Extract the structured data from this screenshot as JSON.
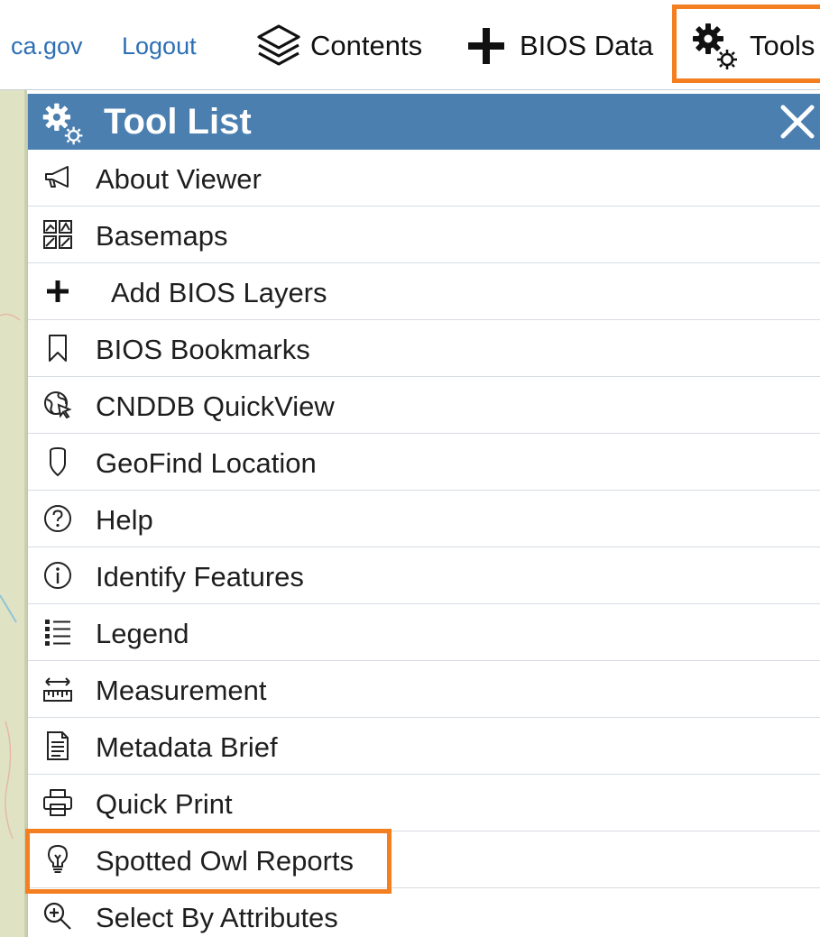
{
  "topbar": {
    "links": [
      {
        "label": "ca.gov"
      },
      {
        "label": "Logout"
      }
    ],
    "buttons": {
      "contents": "Contents",
      "bios_data": "BIOS Data",
      "tools": "Tools"
    }
  },
  "panel": {
    "title": "Tool List",
    "items": [
      {
        "label": "About Viewer",
        "icon": "megaphone-icon"
      },
      {
        "label": "Basemaps",
        "icon": "basemap-grid-icon"
      },
      {
        "label": "Add BIOS Layers",
        "icon": "plus-icon"
      },
      {
        "label": "BIOS Bookmarks",
        "icon": "bookmark-icon"
      },
      {
        "label": "CNDDB QuickView",
        "icon": "globe-cursor-icon"
      },
      {
        "label": "GeoFind Location",
        "icon": "map-pin-icon"
      },
      {
        "label": "Help",
        "icon": "question-circle-icon"
      },
      {
        "label": "Identify Features",
        "icon": "info-circle-icon"
      },
      {
        "label": "Legend",
        "icon": "list-icon"
      },
      {
        "label": "Measurement",
        "icon": "ruler-icon"
      },
      {
        "label": "Metadata Brief",
        "icon": "document-icon"
      },
      {
        "label": "Quick Print",
        "icon": "printer-icon"
      },
      {
        "label": "Spotted Owl Reports",
        "icon": "lightbulb-icon"
      },
      {
        "label": "Select By Attributes",
        "icon": "zoom-plus-icon"
      }
    ]
  },
  "colors": {
    "header": "#4a7fb0",
    "highlight": "#f47f20",
    "link": "#2d6fb4"
  }
}
